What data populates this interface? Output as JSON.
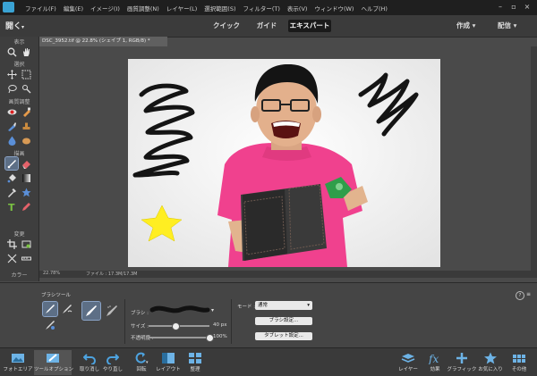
{
  "menubar": {
    "items": [
      "ファイル(F)",
      "編集(E)",
      "イメージ(I)",
      "画質調整(N)",
      "レイヤー(L)",
      "選択範囲(S)",
      "フィルター(T)",
      "表示(V)",
      "ウィンドウ(W)",
      "ヘルプ(H)"
    ]
  },
  "modebar": {
    "open_label": "開く",
    "tabs": [
      "クイック",
      "ガイド",
      "エキスパート"
    ],
    "create_label": "作成",
    "share_label": "配信"
  },
  "document": {
    "tab_title": "DSC_3952.tif @ 22.8% (シェイプ 1, RGB/8) *",
    "zoom": "22.78%",
    "file_info": "ファイル : 17.3M/17.3M"
  },
  "toolbar": {
    "sections": [
      "表示",
      "選択",
      "画質調整",
      "描画",
      "変更",
      "カラー"
    ]
  },
  "options": {
    "tool_name": "ブラシツール",
    "brush_label": "ブラシ :",
    "size_label": "サイズ :",
    "size_value": "40 px",
    "opacity_label": "不透明度 :",
    "opacity_value": "100%",
    "size_fraction": 0.45,
    "opacity_fraction": 1.0,
    "mode_label": "モード :",
    "mode_value": "通常",
    "brush_settings_label": "ブラシ設定...",
    "tablet_settings_label": "タブレット設定..."
  },
  "bottombar": {
    "left": [
      "フォトエリア",
      "ツールオプション",
      "取り消し",
      "やり直し",
      "回転",
      "レイアウト",
      "整理"
    ],
    "right": [
      "レイヤー",
      "効果",
      "グラフィック",
      "お気に入り",
      "その他"
    ]
  },
  "colors": {
    "foreground": "#ffee00",
    "background": "#ffffff",
    "shirt": "#f0418e",
    "star": "#ffee22"
  }
}
